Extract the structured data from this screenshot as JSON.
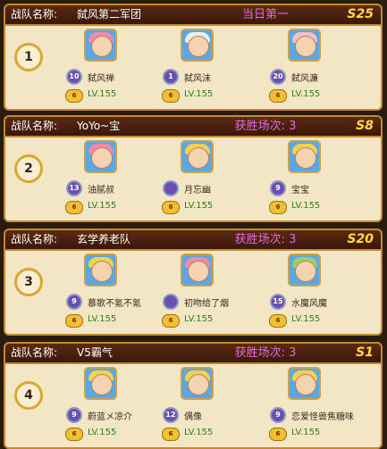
{
  "teams": [
    {
      "rank": "1",
      "team_label": "战队名称:",
      "team_name": "弑风第二军团",
      "win_text": "当日第一",
      "season": "S25",
      "members": [
        {
          "name": "弑风禅",
          "badge": "10",
          "vip": "6",
          "level": "LV.155",
          "avatar": "pink-hair-avatar"
        },
        {
          "name": "弑风沫",
          "badge": "1",
          "vip": "6",
          "level": "LV.155",
          "avatar": "white-hair-avatar"
        },
        {
          "name": "弑风濂",
          "badge": "20",
          "vip": "6",
          "level": "LV.155",
          "avatar": "rabbit-avatar"
        }
      ]
    },
    {
      "rank": "2",
      "team_label": "战队名称:",
      "team_name": "YoYo~宝",
      "win_text": "获胜场次: 3",
      "season": "S8",
      "members": [
        {
          "name": "油腻叔",
          "badge": "13",
          "vip": "6",
          "level": "LV.155",
          "avatar": "pink-hair-avatar"
        },
        {
          "name": "月忘幽",
          "badge": "",
          "vip": "6",
          "level": "LV.155",
          "avatar": "blonde-avatar"
        },
        {
          "name": "宝宝",
          "badge": "9",
          "vip": "6",
          "level": "LV.155",
          "avatar": "blonde-avatar"
        }
      ]
    },
    {
      "rank": "3",
      "team_label": "战队名称:",
      "team_name": "玄学养老队",
      "win_text": "获胜场次: 3",
      "season": "S20",
      "members": [
        {
          "name": "慕歌不氪不氪",
          "badge": "9",
          "vip": "6",
          "level": "LV.155",
          "avatar": "blonde-avatar"
        },
        {
          "name": "初吻给了烟",
          "badge": "",
          "vip": "6",
          "level": "LV.155",
          "avatar": "pink-hair-avatar"
        },
        {
          "name": "水魔风魔",
          "badge": "15",
          "vip": "6",
          "level": "LV.155",
          "avatar": "green-avatar"
        }
      ]
    },
    {
      "rank": "4",
      "team_label": "战队名称:",
      "team_name": "V5霸气",
      "win_text": "获胜场次: 3",
      "season": "S1",
      "members": [
        {
          "name": "蔚蓝メ凉介",
          "badge": "9",
          "vip": "6",
          "level": "LV.155",
          "avatar": "blonde-avatar"
        },
        {
          "name": "偶像",
          "badge": "12",
          "vip": "6",
          "level": "LV.155",
          "avatar": "blonde-avatar"
        },
        {
          "name": "恋爱怪兽焦糖味",
          "badge": "9",
          "vip": "6",
          "level": "LV.155",
          "avatar": "blonde-avatar"
        }
      ]
    }
  ]
}
